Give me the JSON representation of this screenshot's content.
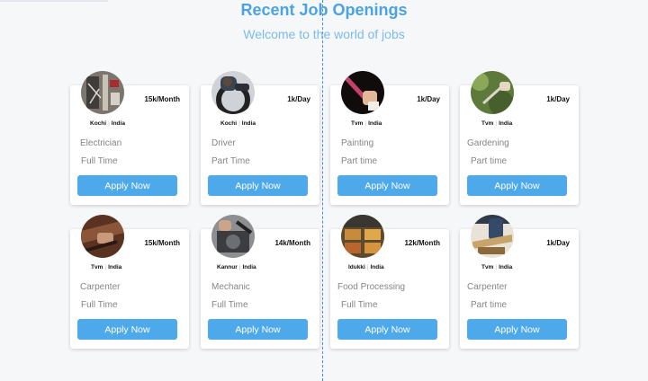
{
  "header": {
    "title": "Recent Job Openings",
    "subtitle": "Welcome to the world of jobs"
  },
  "colors": {
    "accent": "#4ea9ea",
    "title": "#4ba3e3",
    "muted_text": "#858585",
    "background": "#f6f7f9"
  },
  "jobs": [
    {
      "pay": "15k/Month",
      "city": "Kochi",
      "country": "India",
      "title": "Electrician",
      "type": "Full Time",
      "button": "Apply Now",
      "image": "electrician-photo"
    },
    {
      "pay": "1k/Day",
      "city": "Kochi",
      "country": "India",
      "title": "Driver",
      "type": "Part Time",
      "button": "Apply Now",
      "image": "driver-photo"
    },
    {
      "pay": "1k/Day",
      "city": "Tvm",
      "country": "India",
      "title": "Painting",
      "type": "Part time",
      "button": "Apply Now",
      "image": "painting-photo"
    },
    {
      "pay": "1k/Day",
      "city": "Tvm",
      "country": "India",
      "title": "Gardening",
      "type": "Part time",
      "button": "Apply Now",
      "image": "gardening-photo"
    },
    {
      "pay": "15k/Month",
      "city": "Tvm",
      "country": "India",
      "title": "Carpenter",
      "type": "Full Time",
      "button": "Apply Now",
      "image": "carpenter-photo"
    },
    {
      "pay": "14k/Month",
      "city": "Kannur",
      "country": "India",
      "title": "Mechanic",
      "type": "Full Time",
      "button": "Apply Now",
      "image": "mechanic-photo"
    },
    {
      "pay": "12k/Month",
      "city": "Idukki",
      "country": "India",
      "title": "Food Processing",
      "type": "Full Time",
      "button": "Apply Now",
      "image": "food-processing-photo"
    },
    {
      "pay": "1k/Day",
      "city": "Tvm",
      "country": "India",
      "title": "Carpenter",
      "type": "Part time",
      "button": "Apply Now",
      "image": "carpenter-photo"
    }
  ]
}
